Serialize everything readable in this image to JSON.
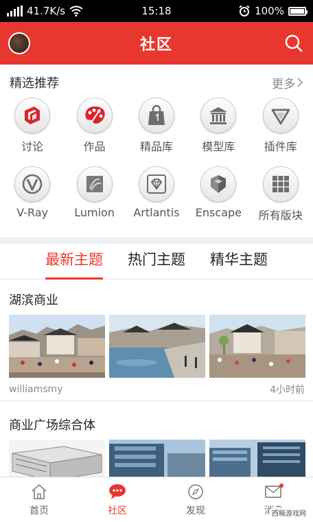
{
  "status_bar": {
    "network_speed": "41.7K/s",
    "time": "15:18",
    "battery": "100%"
  },
  "header": {
    "title": "社区"
  },
  "recommend": {
    "title": "精选推荐",
    "more_label": "更多"
  },
  "categories": [
    {
      "label": "讨论",
      "icon": "sketchup-icon"
    },
    {
      "label": "作品",
      "icon": "palette-icon"
    },
    {
      "label": "精品库",
      "icon": "shopping-bag-icon"
    },
    {
      "label": "模型库",
      "icon": "temple-icon"
    },
    {
      "label": "插件库",
      "icon": "gem-icon"
    },
    {
      "label": "V-Ray",
      "icon": "vray-icon"
    },
    {
      "label": "Lumion",
      "icon": "lumion-icon"
    },
    {
      "label": "Artlantis",
      "icon": "artlantis-icon"
    },
    {
      "label": "Enscape",
      "icon": "enscape-icon"
    },
    {
      "label": "所有版块",
      "icon": "grid-icon"
    }
  ],
  "tabs": [
    {
      "label": "最新主题",
      "active": true
    },
    {
      "label": "热门主题",
      "active": false
    },
    {
      "label": "精华主题",
      "active": false
    }
  ],
  "posts": [
    {
      "title": "湖滨商业",
      "author": "williamsmy",
      "time": "4小时前"
    },
    {
      "title": "商业广场综合体",
      "author": "",
      "time": ""
    }
  ],
  "bottom_nav": [
    {
      "label": "首页",
      "icon": "home-icon",
      "active": false
    },
    {
      "label": "社区",
      "icon": "chat-bubble-icon",
      "active": true
    },
    {
      "label": "发现",
      "icon": "compass-icon",
      "active": false
    },
    {
      "label": "消息",
      "icon": "mail-icon",
      "active": false
    }
  ],
  "watermark": "西楠游戏网",
  "colors": {
    "accent": "#e8372f",
    "text": "#333333",
    "muted": "#888888"
  }
}
